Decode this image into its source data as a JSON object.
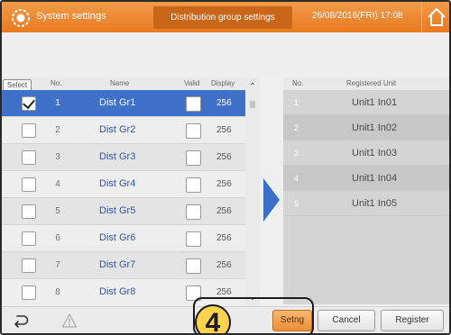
{
  "header": {
    "title": "System settings",
    "screen": "Distribution group settings",
    "datetime": "26/08/2016(FRI) 17:08",
    "home_icon": "home-icon",
    "settings_icon": "settings-icon"
  },
  "table": {
    "headers": {
      "select": "Select",
      "no": "No.",
      "name": "Name",
      "valid": "Valid",
      "display": "Display"
    },
    "rows": [
      {
        "no": "1",
        "name": "Dist Gr1",
        "display": "256",
        "selected": true,
        "valid": false
      },
      {
        "no": "2",
        "name": "Dist Gr2",
        "display": "256",
        "selected": false,
        "valid": false
      },
      {
        "no": "3",
        "name": "Dist Gr3",
        "display": "256",
        "selected": false,
        "valid": false
      },
      {
        "no": "4",
        "name": "Dist Gr4",
        "display": "256",
        "selected": false,
        "valid": false
      },
      {
        "no": "5",
        "name": "Dist Gr5",
        "display": "256",
        "selected": false,
        "valid": false
      },
      {
        "no": "6",
        "name": "Dist Gr6",
        "display": "256",
        "selected": false,
        "valid": false
      },
      {
        "no": "7",
        "name": "Dist Gr7",
        "display": "256",
        "selected": false,
        "valid": false
      },
      {
        "no": "8",
        "name": "Dist Gr8",
        "display": "256",
        "selected": false,
        "valid": false
      }
    ]
  },
  "registered": {
    "headers": {
      "no": "No.",
      "unit": "Registered Unit"
    },
    "rows": [
      {
        "no": "1",
        "unit": "Unit1 In01"
      },
      {
        "no": "2",
        "unit": "Unit1 In02"
      },
      {
        "no": "3",
        "unit": "Unit1 In03"
      },
      {
        "no": "4",
        "unit": "Unit1 In04"
      },
      {
        "no": "5",
        "unit": "Unit1 In05"
      }
    ]
  },
  "footer": {
    "back_icon": "back-icon",
    "warning_icon": "warning-icon",
    "setng": "Setng",
    "cancel": "Cancel",
    "register": "Register"
  },
  "callout": {
    "step": "4"
  },
  "colors": {
    "header": "#e97a21",
    "selected_row": "#4071c8",
    "arrow": "#3b6fc9",
    "name_text": "#2f55b8",
    "setng_button": "#ec8f35"
  }
}
